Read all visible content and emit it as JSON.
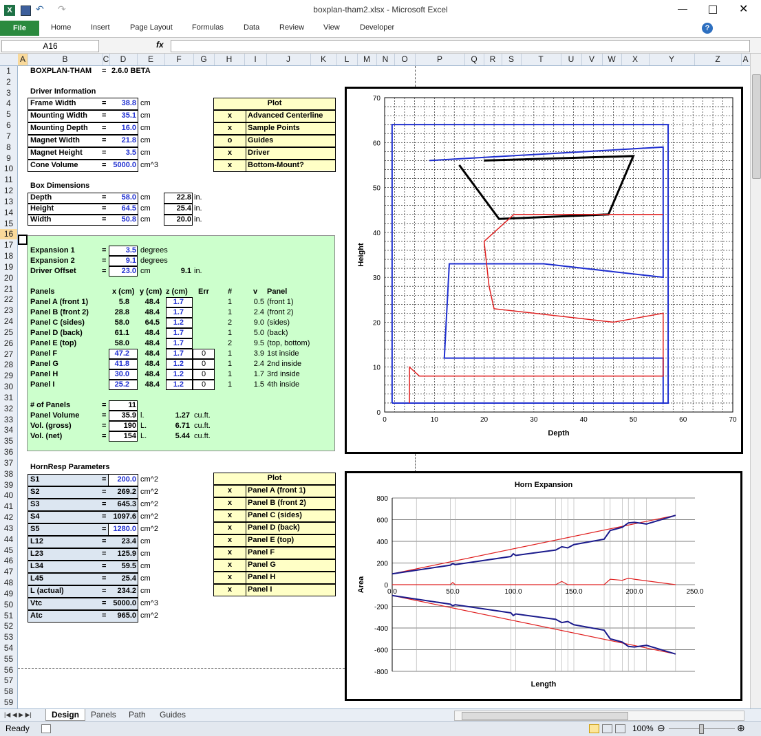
{
  "window": {
    "title": "boxplan-tham2.xlsx  -  Microsoft Excel"
  },
  "ribbon": {
    "file": "File",
    "tabs": [
      "Home",
      "Insert",
      "Page Layout",
      "Formulas",
      "Data",
      "Review",
      "View",
      "Developer"
    ]
  },
  "formula_bar": {
    "name_box": "A16",
    "fx": "fx",
    "content": ""
  },
  "columns": [
    "A",
    "B",
    "C",
    "D",
    "E",
    "F",
    "G",
    "H",
    "I",
    "J",
    "K",
    "L",
    "M",
    "N",
    "O",
    "P",
    "Q",
    "R",
    "S",
    "T",
    "U",
    "V",
    "W",
    "X",
    "Y",
    "Z",
    "A"
  ],
  "header": {
    "title": "BOXPLAN-THAM",
    "eq": "=",
    "version": "2.6.0 BETA"
  },
  "driver": {
    "heading": "Driver Information",
    "rows": [
      {
        "label": "Frame Width",
        "value": "38.8",
        "unit": "cm"
      },
      {
        "label": "Mounting Width",
        "value": "35.1",
        "unit": "cm"
      },
      {
        "label": "Mounting Depth",
        "value": "16.0",
        "unit": "cm"
      },
      {
        "label": "Magnet Width",
        "value": "21.8",
        "unit": "cm"
      },
      {
        "label": "Magnet Height",
        "value": "3.5",
        "unit": "cm"
      },
      {
        "label": "Cone Volume",
        "value": "5000.0",
        "unit": "cm^3"
      }
    ]
  },
  "plot1": {
    "heading": "Plot",
    "rows": [
      {
        "flag": "x",
        "label": "Advanced Centerline"
      },
      {
        "flag": "x",
        "label": "Sample Points"
      },
      {
        "flag": "o",
        "label": "Guides"
      },
      {
        "flag": "x",
        "label": "Driver"
      },
      {
        "flag": "x",
        "label": "Bottom-Mount?"
      }
    ]
  },
  "box": {
    "heading": "Box Dimensions",
    "rows": [
      {
        "label": "Depth",
        "value": "58.0",
        "unit": "cm",
        "inches": "22.8",
        "iunit": "in."
      },
      {
        "label": "Height",
        "value": "64.5",
        "unit": "cm",
        "inches": "25.4",
        "iunit": "in."
      },
      {
        "label": "Width",
        "value": "50.8",
        "unit": "cm",
        "inches": "20.0",
        "iunit": "in."
      }
    ]
  },
  "expansion": {
    "rows": [
      {
        "label": "Expansion 1",
        "value": "3.5",
        "unit": "degrees",
        "extra": ""
      },
      {
        "label": "Expansion 2",
        "value": "9.1",
        "unit": "degrees",
        "extra": ""
      },
      {
        "label": "Driver Offset",
        "value": "23.0",
        "unit": "cm",
        "extra": "9.1"
      }
    ],
    "extra_unit": "in."
  },
  "panels": {
    "headers": [
      "Panels",
      "x (cm)",
      "y (cm)",
      "z (cm)",
      "Err",
      "#",
      "v",
      "Panel"
    ],
    "rows": [
      {
        "name": "Panel A (front 1)",
        "x": "5.8",
        "y": "48.4",
        "z": "1.7",
        "err": "",
        "n": "1",
        "v": "0.5",
        "desc": "(front 1)"
      },
      {
        "name": "Panel B (front 2)",
        "x": "28.8",
        "y": "48.4",
        "z": "1.7",
        "err": "",
        "n": "1",
        "v": "2.4",
        "desc": "(front 2)"
      },
      {
        "name": "Panel C (sides)",
        "x": "58.0",
        "y": "64.5",
        "z": "1.2",
        "err": "",
        "n": "2",
        "v": "9.0",
        "desc": "(sides)"
      },
      {
        "name": "Panel D (back)",
        "x": "61.1",
        "y": "48.4",
        "z": "1.7",
        "err": "",
        "n": "1",
        "v": "5.0",
        "desc": "(back)"
      },
      {
        "name": "Panel E (top)",
        "x": "58.0",
        "y": "48.4",
        "z": "1.7",
        "err": "",
        "n": "2",
        "v": "9.5",
        "desc": "(top, bottom)"
      },
      {
        "name": "Panel F",
        "x": "47.2",
        "y": "48.4",
        "z": "1.7",
        "err": "0",
        "n": "1",
        "v": "3.9",
        "desc": "1st inside"
      },
      {
        "name": "Panel G",
        "x": "41.8",
        "y": "48.4",
        "z": "1.2",
        "err": "0",
        "n": "1",
        "v": "2.4",
        "desc": "2nd inside"
      },
      {
        "name": "Panel H",
        "x": "30.0",
        "y": "48.4",
        "z": "1.2",
        "err": "0",
        "n": "1",
        "v": "1.7",
        "desc": "3rd inside"
      },
      {
        "name": "Panel I",
        "x": "25.2",
        "y": "48.4",
        "z": "1.2",
        "err": "0",
        "n": "1",
        "v": "1.5",
        "desc": "4th inside"
      }
    ]
  },
  "volumes": {
    "rows": [
      {
        "label": "# of Panels",
        "value": "11",
        "unit": "",
        "cuft": "",
        "cunit": ""
      },
      {
        "label": "Panel Volume",
        "value": "35.9",
        "unit": "l.",
        "cuft": "1.27",
        "cunit": "cu.ft."
      },
      {
        "label": "Vol. (gross)",
        "value": "190",
        "unit": "L.",
        "cuft": "6.71",
        "cunit": "cu.ft."
      },
      {
        "label": "Vol. (net)",
        "value": "154",
        "unit": "L.",
        "cuft": "5.44",
        "cunit": "cu.ft."
      }
    ]
  },
  "hornresp": {
    "heading": "HornResp Parameters",
    "rows": [
      {
        "label": "S1",
        "value": "200.0",
        "unit": "cm^2"
      },
      {
        "label": "S2",
        "value": "269.2",
        "unit": "cm^2"
      },
      {
        "label": "S3",
        "value": "645.3",
        "unit": "cm^2"
      },
      {
        "label": "S4",
        "value": "1097.6",
        "unit": "cm^2"
      },
      {
        "label": "S5",
        "value": "1280.0",
        "unit": "cm^2"
      },
      {
        "label": "L12",
        "value": "23.4",
        "unit": "cm"
      },
      {
        "label": "L23",
        "value": "125.9",
        "unit": "cm"
      },
      {
        "label": "L34",
        "value": "59.5",
        "unit": "cm"
      },
      {
        "label": "L45",
        "value": "25.4",
        "unit": "cm"
      },
      {
        "label": "L (actual)",
        "value": "234.2",
        "unit": "cm"
      },
      {
        "label": "Vtc",
        "value": "5000.0",
        "unit": "cm^3"
      },
      {
        "label": "Atc",
        "value": "965.0",
        "unit": "cm^2"
      }
    ]
  },
  "plot2": {
    "heading": "Plot",
    "rows": [
      {
        "flag": "x",
        "label": "Panel A (front 1)"
      },
      {
        "flag": "x",
        "label": "Panel B (front 2)"
      },
      {
        "flag": "x",
        "label": "Panel C (sides)"
      },
      {
        "flag": "x",
        "label": "Panel D (back)"
      },
      {
        "flag": "x",
        "label": "Panel E (top)"
      },
      {
        "flag": "x",
        "label": "Panel F"
      },
      {
        "flag": "x",
        "label": "Panel G"
      },
      {
        "flag": "x",
        "label": "Panel H"
      },
      {
        "flag": "x",
        "label": "Panel I"
      }
    ]
  },
  "chart_data": [
    {
      "type": "scatter",
      "title": "",
      "xlabel": "Depth",
      "ylabel": "Height",
      "xlim": [
        0,
        70
      ],
      "ylim": [
        0,
        70
      ],
      "xticks": [
        "0",
        "10",
        "20",
        "30",
        "40",
        "50",
        "60",
        "70"
      ],
      "yticks": [
        "0",
        "10",
        "20",
        "30",
        "40",
        "50",
        "60",
        "70"
      ],
      "grid": true,
      "series": [
        {
          "color": "#1f2fd0",
          "points": [
            [
              1.5,
              2
            ],
            [
              57,
              2
            ],
            [
              57,
              64
            ],
            [
              1.5,
              64
            ],
            [
              1.5,
              2
            ]
          ]
        },
        {
          "color": "#1f2fd0",
          "points": [
            [
              9,
              56
            ],
            [
              56,
              59
            ],
            [
              56,
              30
            ],
            [
              32,
              33
            ],
            [
              13,
              33
            ],
            [
              12,
              12
            ],
            [
              56,
              12
            ],
            [
              56,
              2
            ]
          ]
        },
        {
          "color": "#000000",
          "points": [
            [
              15,
              55
            ],
            [
              23,
              43
            ],
            [
              45,
              44
            ],
            [
              50,
              57
            ],
            [
              20,
              56
            ]
          ]
        }
      ]
    },
    {
      "type": "line",
      "title": "Horn Expansion",
      "xlabel": "Length",
      "ylabel": "Area",
      "xlim": [
        0,
        250
      ],
      "ylim": [
        -800,
        800
      ],
      "xticks": [
        "0.0",
        "50.0",
        "100.0",
        "150.0",
        "200.0",
        "250.0"
      ],
      "yticks": [
        "800",
        "600",
        "400",
        "200",
        "0",
        "-200",
        "-400",
        "-600",
        "-800"
      ],
      "series": [
        {
          "color": "#e02020",
          "x": [
            0,
            234
          ],
          "y": [
            100,
            640
          ]
        },
        {
          "color": "#1a1a8c",
          "x": [
            0,
            48,
            50,
            52,
            98,
            100,
            102,
            135,
            140,
            145,
            150,
            175,
            180,
            190,
            195,
            200,
            210,
            234
          ],
          "y": [
            100,
            180,
            195,
            185,
            260,
            285,
            270,
            320,
            350,
            340,
            370,
            420,
            500,
            530,
            570,
            575,
            560,
            640
          ]
        },
        {
          "color": "#e02020",
          "x": [
            0,
            48,
            50,
            52,
            135,
            140,
            145,
            175,
            180,
            190,
            195,
            200,
            234
          ],
          "y": [
            0,
            0,
            20,
            0,
            0,
            30,
            0,
            0,
            50,
            40,
            60,
            50,
            0
          ]
        },
        {
          "color": "#e02020",
          "x": [
            0,
            234
          ],
          "y": [
            -100,
            -640
          ]
        },
        {
          "color": "#1a1a8c",
          "x": [
            0,
            48,
            50,
            52,
            98,
            100,
            102,
            135,
            140,
            145,
            150,
            175,
            180,
            190,
            195,
            200,
            210,
            234
          ],
          "y": [
            -100,
            -180,
            -195,
            -185,
            -260,
            -285,
            -270,
            -320,
            -350,
            -340,
            -370,
            -420,
            -500,
            -530,
            -570,
            -575,
            -560,
            -640
          ]
        }
      ]
    }
  ],
  "sheets": {
    "tabs": [
      "Design",
      "Panels",
      "Path",
      "Guides"
    ],
    "active": "Design"
  },
  "status": {
    "ready": "Ready",
    "zoom": "100%"
  }
}
